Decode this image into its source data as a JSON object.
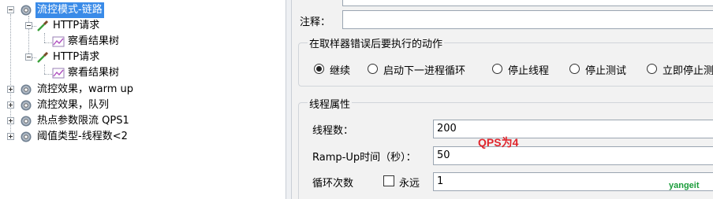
{
  "tree": {
    "nodes": [
      {
        "label": "流控模式-链路"
      },
      {
        "label": "HTTP请求"
      },
      {
        "label": "察看结果树"
      },
      {
        "label": "HTTP请求"
      },
      {
        "label": "察看结果树"
      },
      {
        "label": "流控效果，warm up"
      },
      {
        "label": "流控效果，队列"
      },
      {
        "label": "热点参数限流 QPS1"
      },
      {
        "label": "阈值类型-线程数<2"
      }
    ]
  },
  "form": {
    "comment_label": "注释：",
    "comment_value": "",
    "error_group_title": "在取样器错误后要执行的动作",
    "error_actions": [
      {
        "label": "继续",
        "selected": true
      },
      {
        "label": "启动下一进程循环",
        "selected": false
      },
      {
        "label": "停止线程",
        "selected": false
      },
      {
        "label": "停止测试",
        "selected": false
      },
      {
        "label": "立即停止测"
      }
    ],
    "thread_group_title": "线程属性",
    "threads_label": "线程数：",
    "threads_value": "200",
    "rampup_label": "Ramp-Up时间（秒）：",
    "rampup_value": "50",
    "loop_label": "循环次数",
    "forever_label": "永远",
    "forever_checked": false,
    "loop_value": "1"
  },
  "annotation": "QPS为4",
  "watermark": "yangeit"
}
